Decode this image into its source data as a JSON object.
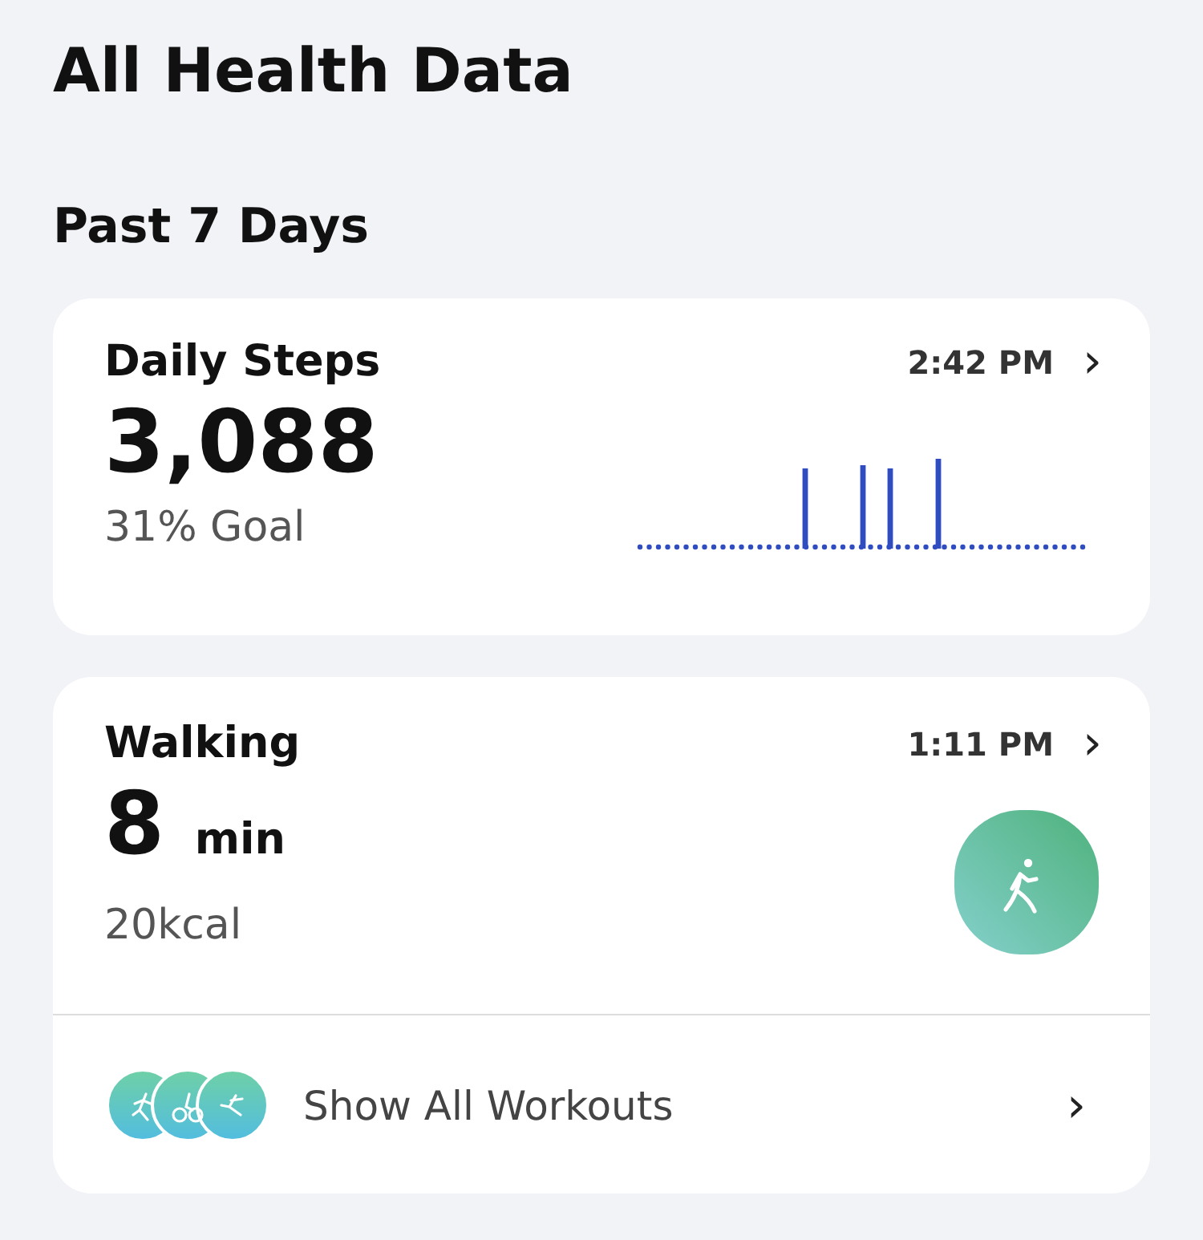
{
  "title": "All Health Data",
  "section": "Past 7 Days",
  "steps_card": {
    "title": "Daily Steps",
    "time": "2:42 PM",
    "chevron": "›",
    "value": "3,088",
    "goal": "31% Goal"
  },
  "walking_card": {
    "title": "Walking",
    "time": "1:11 PM",
    "chevron": "›",
    "value": "8",
    "unit": "min",
    "calories": "20kcal"
  },
  "workouts_row": {
    "label": "Show All Workouts",
    "chevron": "›"
  }
}
